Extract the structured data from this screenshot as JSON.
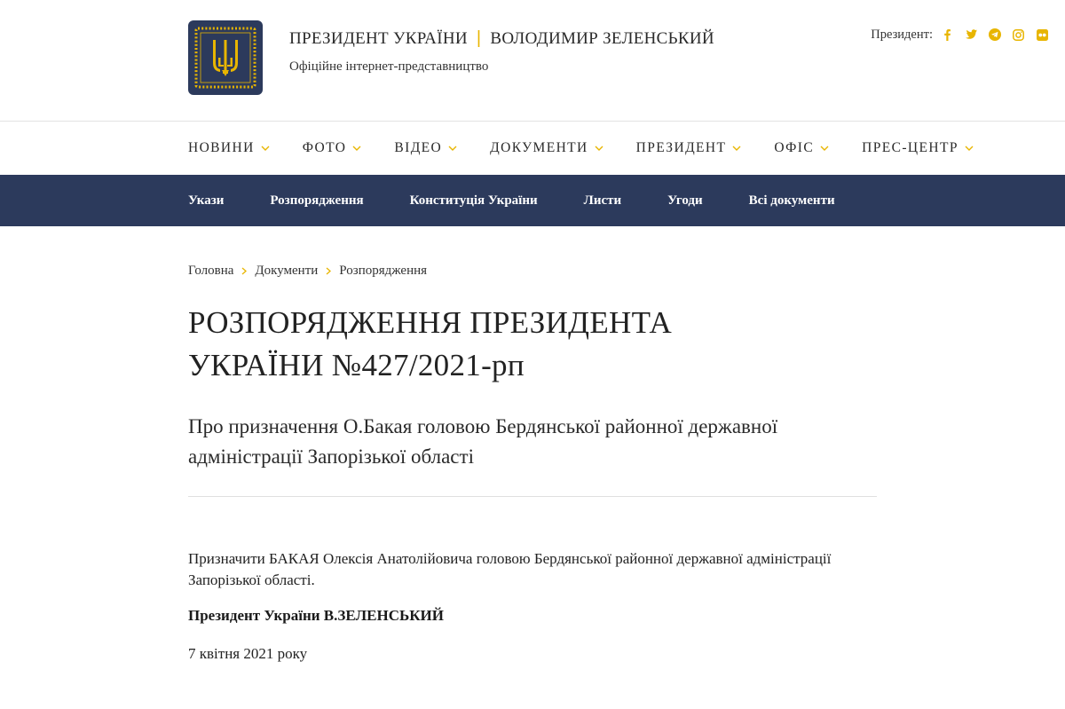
{
  "header": {
    "title_left": "ПРЕЗИДЕНТ УКРАЇНИ",
    "title_sep": "|",
    "title_right": "ВОЛОДИМИР ЗЕЛЕНСЬКИЙ",
    "subtitle": "Офіційне інтернет-представництво",
    "social_label": "Президент:",
    "social_icons": [
      "facebook-icon",
      "twitter-icon",
      "telegram-icon",
      "instagram-icon",
      "flickr-icon"
    ],
    "logo_icon": "trident-emblem"
  },
  "main_nav": {
    "items": [
      {
        "label": "НОВИНИ"
      },
      {
        "label": "ФОТО"
      },
      {
        "label": "ВІДЕО"
      },
      {
        "label": "ДОКУМЕНТИ"
      },
      {
        "label": "ПРЕЗИДЕНТ"
      },
      {
        "label": "ОФІС"
      },
      {
        "label": "ПРЕС-ЦЕНТР"
      }
    ]
  },
  "sub_nav": {
    "items": [
      {
        "label": "Укази"
      },
      {
        "label": "Розпорядження"
      },
      {
        "label": "Конституція України"
      },
      {
        "label": "Листи"
      },
      {
        "label": "Угоди"
      },
      {
        "label": "Всі документи"
      }
    ]
  },
  "breadcrumb": {
    "items": [
      {
        "label": "Головна"
      },
      {
        "label": "Документи"
      },
      {
        "label": "Розпорядження"
      }
    ]
  },
  "document": {
    "title": "РОЗПОРЯДЖЕННЯ ПРЕЗИДЕНТА УКРАЇНИ №427/2021-рп",
    "subtitle": "Про призначення О.Бакая головою Бердянської районної державної адміністрації Запорізької області",
    "body": "Призначити БАКАЯ Олексія Анатолійовича головою Бердянської районної державної адміністрації Запорізької області.",
    "signature": "Президент України В.ЗЕЛЕНСЬКИЙ",
    "date": "7 квітня 2021 року"
  },
  "colors": {
    "accent": "#e8b500",
    "navy": "#2c3a5c",
    "text": "#222222"
  }
}
